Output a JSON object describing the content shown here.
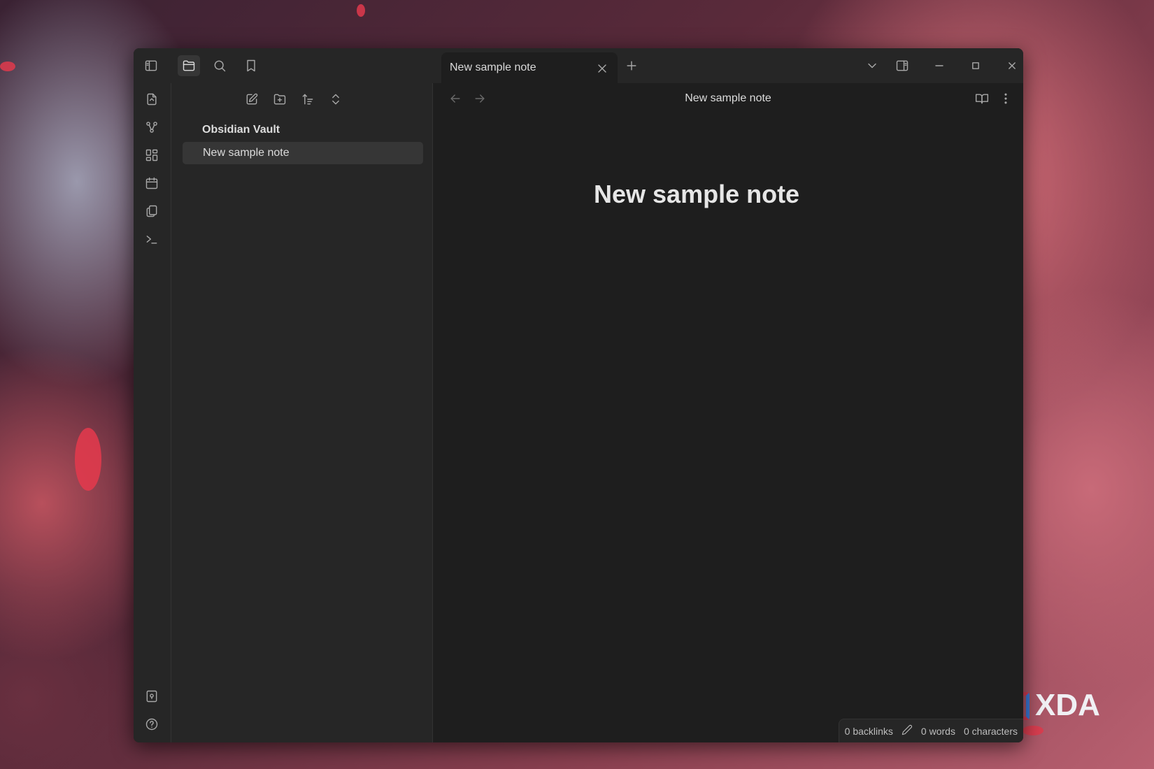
{
  "window": {
    "tab_title": "New sample note",
    "view_header_title": "New sample note",
    "note_heading": "New sample note"
  },
  "titlebar": {
    "icons": [
      "sidebar-toggle-icon",
      "folder-icon",
      "search-icon",
      "bookmark-icon",
      "plus-icon",
      "chevron-down-icon",
      "split-pane-icon",
      "minimize-icon",
      "maximize-icon",
      "close-icon"
    ]
  },
  "ribbon": {
    "top_icons": [
      "open-switcher-icon",
      "graph-view-icon",
      "canvas-icon",
      "daily-note-icon",
      "templates-icon",
      "command-palette-icon"
    ],
    "bottom_icons": [
      "vault-switch-icon",
      "help-icon",
      "settings-icon"
    ]
  },
  "sidebar": {
    "toolbar_icons": [
      "new-note-icon",
      "new-folder-icon",
      "sort-icon",
      "collapse-icon"
    ],
    "vault_name": "Obsidian Vault",
    "files": [
      "New sample note"
    ]
  },
  "statusbar": {
    "backlinks": "0 backlinks",
    "words": "0 words",
    "characters": "0 characters"
  },
  "watermark": {
    "brand": "XDA"
  }
}
